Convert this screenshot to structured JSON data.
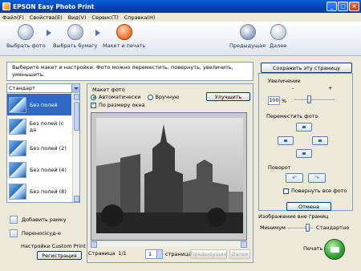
{
  "window": {
    "title": "EPSON Easy Photo Print"
  },
  "menu": [
    "Файл(F)",
    "Свойства(E)",
    "Вид(V)",
    "Сервис(T)",
    "Справка(H)"
  ],
  "toolbar": {
    "steps": [
      "Выбрать фото",
      "Выбрать бумагу",
      "Макет и печать"
    ],
    "prev": "Предыдущая",
    "next": "Далее"
  },
  "instruction": "Выберите макет и настройки. Фото можно переместить, повернуть, увеличить, уменьшить.",
  "save_page": "Сохранить эту страницу",
  "left": {
    "layout_value": "Стандарт",
    "layouts": [
      "Без полей",
      "Без полей (с да",
      "Без полей (2)",
      "Без полей (4)",
      "Без полей (8)"
    ],
    "add_frame": "Добавить рамку",
    "transfer": "Переносiсуд-е",
    "custom_print": "Настройки Custom Print",
    "register": "Регистрация"
  },
  "center": {
    "title": "Макет фото",
    "auto": "Автоматически",
    "manual": "Вручную",
    "fit": "По размеру окна",
    "improve": "Улучшить",
    "page_label": "Страница",
    "page_count": "1/1",
    "page_value": "1",
    "page_word": "страница",
    "prev_page": "Предыдущая",
    "next_page": "Далее"
  },
  "right": {
    "zoom_label": "Увеличение",
    "zoom_minus": "-",
    "zoom_plus": "+",
    "zoom_value": "100",
    "zoom_unit": "%",
    "move_label": "Переместить фото",
    "rotate_label": "Поворот",
    "rotate_all": "Повернуть все фото",
    "cancel": "Отмена",
    "quality_label": "Изображение вне границ",
    "min_label": "Минимум",
    "std_label": "Стандартно",
    "print": "Печать"
  }
}
